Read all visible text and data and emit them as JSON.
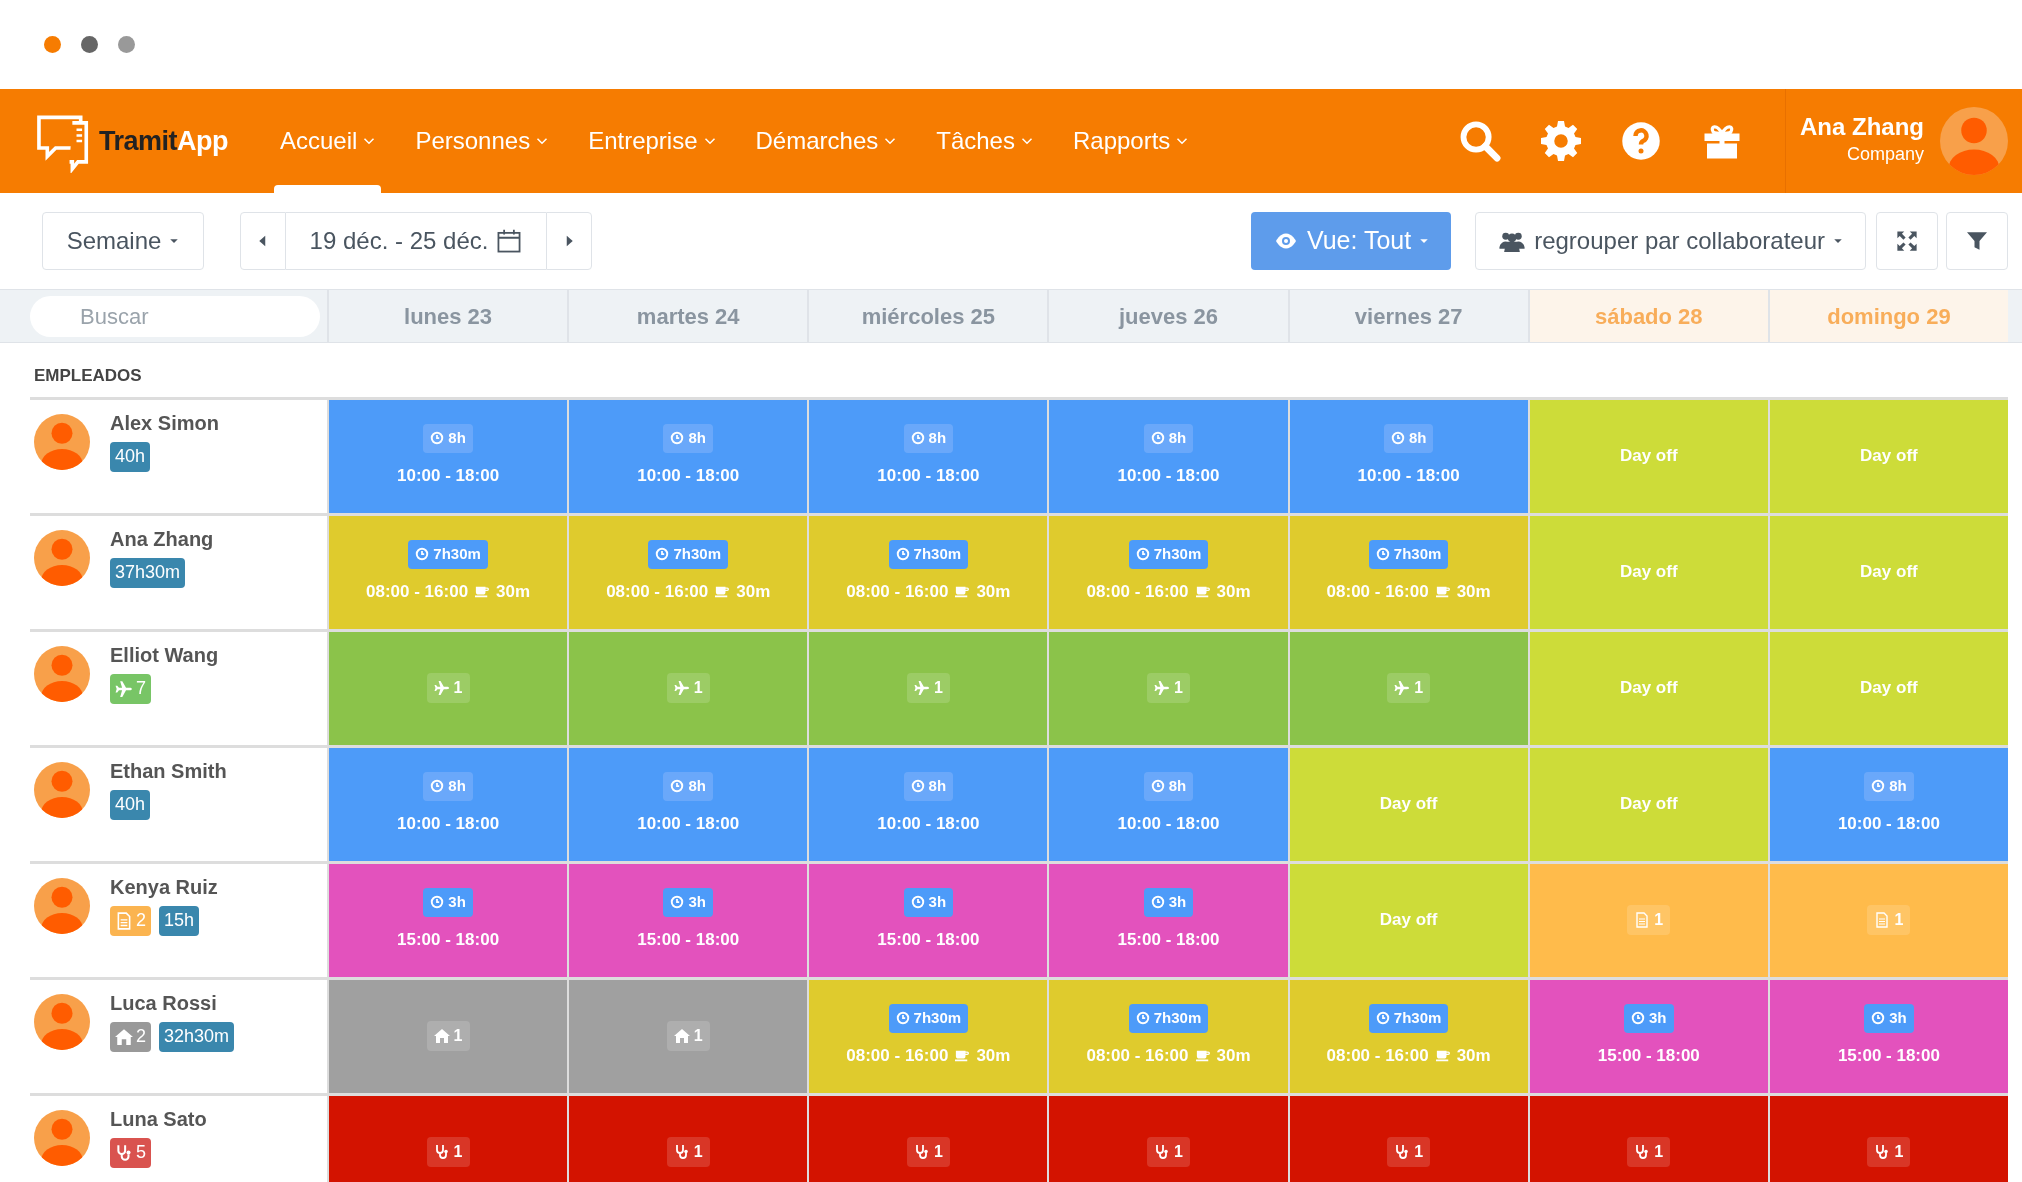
{
  "logo": {
    "text": "Tramit",
    "accent": "App"
  },
  "nav": [
    {
      "label": "Accueil",
      "selected": true
    },
    {
      "label": "Personnes",
      "selected": false
    },
    {
      "label": "Entreprise",
      "selected": false
    },
    {
      "label": "Démarches",
      "selected": false
    },
    {
      "label": "Tâches",
      "selected": false
    },
    {
      "label": "Rapports",
      "selected": false
    }
  ],
  "user": {
    "name": "Ana Zhang",
    "company": "Company"
  },
  "toolbar": {
    "period": "Semaine",
    "range": "19 déc. - 25 déc.",
    "view": "Vue: Tout",
    "group": "regrouper par collaborateur"
  },
  "search": {
    "placeholder": "Buscar"
  },
  "days": [
    {
      "label": "lunes 23",
      "weekend": false
    },
    {
      "label": "martes 24",
      "weekend": false
    },
    {
      "label": "miércoles 25",
      "weekend": false
    },
    {
      "label": "jueves 26",
      "weekend": false
    },
    {
      "label": "viernes 27",
      "weekend": false
    },
    {
      "label": "sábado 28",
      "weekend": true
    },
    {
      "label": "domingo 29",
      "weekend": true
    }
  ],
  "section": "EMPLEADOS",
  "employees": [
    {
      "name": "Alex Simon",
      "badges": [
        {
          "kind": "hours",
          "text": "40h"
        }
      ],
      "days": [
        {
          "kind": "shift",
          "color": "#4d9bf9",
          "hours": "8h",
          "time": "10:00 - 18:00"
        },
        {
          "kind": "shift",
          "color": "#4d9bf9",
          "hours": "8h",
          "time": "10:00 - 18:00"
        },
        {
          "kind": "shift",
          "color": "#4d9bf9",
          "hours": "8h",
          "time": "10:00 - 18:00"
        },
        {
          "kind": "shift",
          "color": "#4d9bf9",
          "hours": "8h",
          "time": "10:00 - 18:00"
        },
        {
          "kind": "shift",
          "color": "#4d9bf9",
          "hours": "8h",
          "time": "10:00 - 18:00"
        },
        {
          "kind": "dayoff",
          "color": "#cddc39",
          "label": "Day off"
        },
        {
          "kind": "dayoff",
          "color": "#cddc39",
          "label": "Day off"
        }
      ]
    },
    {
      "name": "Ana Zhang",
      "badges": [
        {
          "kind": "hours",
          "text": "37h30m"
        }
      ],
      "days": [
        {
          "kind": "shift",
          "color": "#dfcb2d",
          "hours": "7h30m",
          "time": "08:00 - 16:00",
          "break": "30m"
        },
        {
          "kind": "shift",
          "color": "#dfcb2d",
          "hours": "7h30m",
          "time": "08:00 - 16:00",
          "break": "30m"
        },
        {
          "kind": "shift",
          "color": "#dfcb2d",
          "hours": "7h30m",
          "time": "08:00 - 16:00",
          "break": "30m"
        },
        {
          "kind": "shift",
          "color": "#dfcb2d",
          "hours": "7h30m",
          "time": "08:00 - 16:00",
          "break": "30m"
        },
        {
          "kind": "shift",
          "color": "#dfcb2d",
          "hours": "7h30m",
          "time": "08:00 - 16:00",
          "break": "30m"
        },
        {
          "kind": "dayoff",
          "color": "#cddc39",
          "label": "Day off"
        },
        {
          "kind": "dayoff",
          "color": "#cddc39",
          "label": "Day off"
        }
      ]
    },
    {
      "name": "Elliot Wang",
      "badges": [
        {
          "kind": "vacation",
          "text": "7"
        }
      ],
      "days": [
        {
          "kind": "vacation",
          "color": "#8bc34a",
          "count": "1"
        },
        {
          "kind": "vacation",
          "color": "#8bc34a",
          "count": "1"
        },
        {
          "kind": "vacation",
          "color": "#8bc34a",
          "count": "1"
        },
        {
          "kind": "vacation",
          "color": "#8bc34a",
          "count": "1"
        },
        {
          "kind": "vacation",
          "color": "#8bc34a",
          "count": "1"
        },
        {
          "kind": "dayoff",
          "color": "#cddc39",
          "label": "Day off"
        },
        {
          "kind": "dayoff",
          "color": "#cddc39",
          "label": "Day off"
        }
      ]
    },
    {
      "name": "Ethan Smith",
      "badges": [
        {
          "kind": "hours",
          "text": "40h"
        }
      ],
      "days": [
        {
          "kind": "shift",
          "color": "#4d9bf9",
          "hours": "8h",
          "time": "10:00 - 18:00"
        },
        {
          "kind": "shift",
          "color": "#4d9bf9",
          "hours": "8h",
          "time": "10:00 - 18:00"
        },
        {
          "kind": "shift",
          "color": "#4d9bf9",
          "hours": "8h",
          "time": "10:00 - 18:00"
        },
        {
          "kind": "shift",
          "color": "#4d9bf9",
          "hours": "8h",
          "time": "10:00 - 18:00"
        },
        {
          "kind": "dayoff",
          "color": "#cddc39",
          "label": "Day off"
        },
        {
          "kind": "dayoff",
          "color": "#cddc39",
          "label": "Day off"
        },
        {
          "kind": "shift",
          "color": "#4d9bf9",
          "hours": "8h",
          "time": "10:00 - 18:00"
        }
      ]
    },
    {
      "name": "Kenya Ruiz",
      "badges": [
        {
          "kind": "document",
          "text": "2"
        },
        {
          "kind": "hours",
          "text": "15h"
        }
      ],
      "days": [
        {
          "kind": "shift",
          "color": "#e352bd",
          "hours": "3h",
          "time": "15:00 - 18:00"
        },
        {
          "kind": "shift",
          "color": "#e352bd",
          "hours": "3h",
          "time": "15:00 - 18:00"
        },
        {
          "kind": "shift",
          "color": "#e352bd",
          "hours": "3h",
          "time": "15:00 - 18:00"
        },
        {
          "kind": "shift",
          "color": "#e352bd",
          "hours": "3h",
          "time": "15:00 - 18:00"
        },
        {
          "kind": "dayoff",
          "color": "#cddc39",
          "label": "Day off"
        },
        {
          "kind": "document",
          "color": "#ffbb4b",
          "count": "1"
        },
        {
          "kind": "document",
          "color": "#ffbb4b",
          "count": "1"
        }
      ]
    },
    {
      "name": "Luca Rossi",
      "badges": [
        {
          "kind": "home",
          "text": "2"
        },
        {
          "kind": "hours",
          "text": "32h30m"
        }
      ],
      "days": [
        {
          "kind": "home",
          "color": "#a0a0a0",
          "count": "1"
        },
        {
          "kind": "home",
          "color": "#a0a0a0",
          "count": "1"
        },
        {
          "kind": "shift",
          "color": "#dfcb2d",
          "hours": "7h30m",
          "time": "08:00 - 16:00",
          "break": "30m"
        },
        {
          "kind": "shift",
          "color": "#dfcb2d",
          "hours": "7h30m",
          "time": "08:00 - 16:00",
          "break": "30m"
        },
        {
          "kind": "shift",
          "color": "#dfcb2d",
          "hours": "7h30m",
          "time": "08:00 - 16:00",
          "break": "30m"
        },
        {
          "kind": "shift",
          "color": "#e352bd",
          "hours": "3h",
          "time": "15:00 - 18:00"
        },
        {
          "kind": "shift",
          "color": "#e352bd",
          "hours": "3h",
          "time": "15:00 - 18:00"
        }
      ]
    },
    {
      "name": "Luna Sato",
      "badges": [
        {
          "kind": "sick",
          "text": "5"
        }
      ],
      "days": [
        {
          "kind": "sick",
          "color": "#d31300",
          "count": "1"
        },
        {
          "kind": "sick",
          "color": "#d31300",
          "count": "1"
        },
        {
          "kind": "sick",
          "color": "#d31300",
          "count": "1"
        },
        {
          "kind": "sick",
          "color": "#d31300",
          "count": "1"
        },
        {
          "kind": "sick",
          "color": "#d31300",
          "count": "1"
        },
        {
          "kind": "sick",
          "color": "#d31300",
          "count": "1"
        },
        {
          "kind": "sick",
          "color": "#d31300",
          "count": "1"
        }
      ]
    }
  ]
}
